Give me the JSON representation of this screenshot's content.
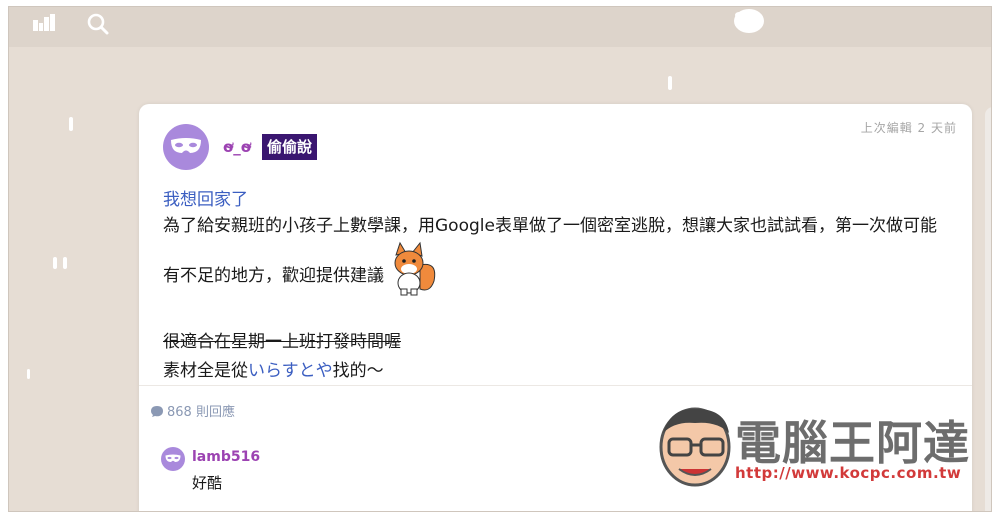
{
  "topbar": {
    "home_icon": "home-icon",
    "search_icon": "search-icon",
    "avatar_icon": "user-avatar-icon"
  },
  "post": {
    "author": "ơ̴_ơ̴",
    "badge": "偷偷說",
    "edited": "上次編輯 2 天前",
    "title": "我想回家了",
    "body_line1": "為了給安親班的小孩子上數學課，用Google表單做了一個密室逃脫，想讓大家也試試看，第一次做可能有不足的地方，歡迎提供建議",
    "strike_line": "很適合在星期一上班打發時間喔",
    "source_prefix": "素材全是從",
    "source_link": "いらすとや",
    "source_suffix": "找的～",
    "avatar_icon": "mask-icon",
    "sticker_icon": "fox-sticker"
  },
  "replies": {
    "count_label": "868 則回應",
    "icon": "comment-bubble-icon"
  },
  "comment": {
    "author": "lamb516",
    "text": "好酷",
    "avatar_icon": "mask-icon"
  },
  "watermark": {
    "title": "電腦王阿達",
    "url": "http://www.kocpc.com.tw"
  },
  "colors": {
    "background": "#e6ddd4",
    "name": "#9c43b2",
    "badge": "#3a1670",
    "link": "#3b5ec1"
  }
}
